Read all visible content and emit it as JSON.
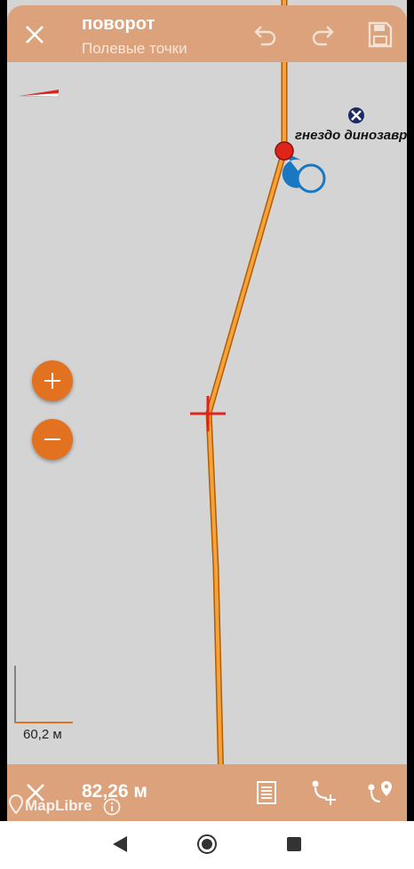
{
  "header": {
    "title": "поворот",
    "subtitle": "Полевые точки",
    "close_icon": "close-icon",
    "undo_icon": "undo-icon",
    "redo_icon": "redo-icon",
    "save_icon": "save-icon"
  },
  "map": {
    "waypoint_label": "гнездо динозавр",
    "scale_label": "60,2 м",
    "attribution": "MapLibre",
    "route_color": "#f28c1a",
    "marker_color": "#e0241a",
    "accent_color": "#e2721f"
  },
  "zoom": {
    "in_icon": "plus-icon",
    "out_icon": "minus-icon"
  },
  "footer": {
    "distance": "82,26 м",
    "close_icon": "close-icon",
    "list_icon": "list-icon",
    "add_point_icon": "add-route-point-icon",
    "route_to_point_icon": "route-to-point-icon"
  },
  "system_nav": {
    "back_icon": "back-icon",
    "home_icon": "home-icon",
    "recents_icon": "recents-icon"
  }
}
